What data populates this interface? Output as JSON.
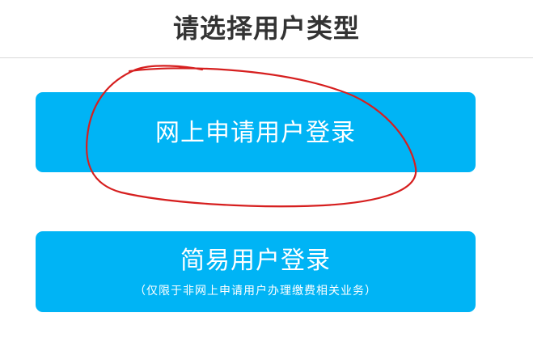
{
  "header": {
    "title": "请选择用户类型"
  },
  "buttons": {
    "online": {
      "label": "网上申请用户登录"
    },
    "simple": {
      "label": "简易用户登录",
      "note": "（仅限于非网上申请用户办理缴费相关业务）"
    }
  },
  "colors": {
    "button_bg": "#00b4f5",
    "button_text": "#ffffff",
    "title_text": "#333333",
    "annotation_stroke": "#d61f1f"
  }
}
